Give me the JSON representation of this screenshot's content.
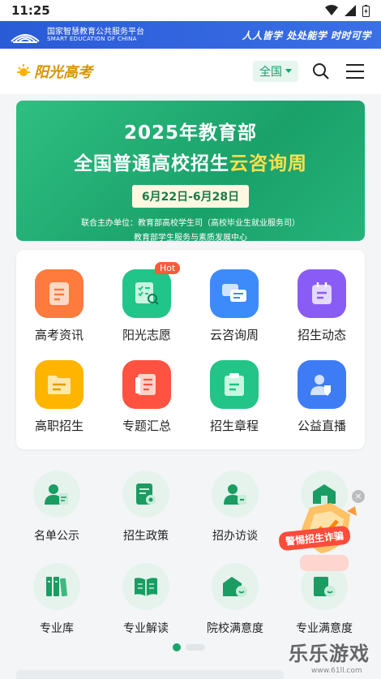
{
  "status": {
    "time": "11:25"
  },
  "platform": {
    "name_cn": "国家智慧教育公共服务平台",
    "name_en": "SMART EDUCATION OF CHINA",
    "slogan": "人人皆学 处处能学 时时可学"
  },
  "header": {
    "brand": "阳光高考",
    "region": "全国"
  },
  "hero": {
    "line1": "2025年教育部",
    "line2_pre": "全国普通高校招生",
    "line2_highlight": "云咨询周",
    "dates": "6月22日-6月28日",
    "organizer1": "联合主办单位：教育部高校学生司（高校毕业生就业服务司）",
    "organizer2": "教育部学生服务与素质发展中心"
  },
  "grid": [
    {
      "label": "高考资讯",
      "color": "#ff7a3d"
    },
    {
      "label": "阳光志愿",
      "color": "#21c58a",
      "badge": "Hot"
    },
    {
      "label": "云咨询周",
      "color": "#3d8bfb"
    },
    {
      "label": "招生动态",
      "color": "#8a5cf6"
    },
    {
      "label": "高职招生",
      "color": "#ffb400"
    },
    {
      "label": "专题汇总",
      "color": "#ff5240"
    },
    {
      "label": "招生章程",
      "color": "#22c488"
    },
    {
      "label": "公益直播",
      "color": "#3d7cf5"
    }
  ],
  "secondary": [
    {
      "label": "名单公示",
      "icon": "person-list-icon"
    },
    {
      "label": "招生政策",
      "icon": "policy-doc-icon"
    },
    {
      "label": "招办访谈",
      "icon": "interview-icon"
    },
    {
      "label": "",
      "icon": "school-icon"
    },
    {
      "label": "专业库",
      "icon": "books-icon"
    },
    {
      "label": "专业解读",
      "icon": "open-book-icon"
    },
    {
      "label": "院校满意度",
      "icon": "school-smile-icon"
    },
    {
      "label": "专业满意度",
      "icon": "major-smile-icon"
    }
  ],
  "floating": {
    "label": "警惕招生诈骗",
    "close": "×"
  },
  "watermark": {
    "text": "乐乐游戏",
    "url": "www.61ll.com"
  }
}
